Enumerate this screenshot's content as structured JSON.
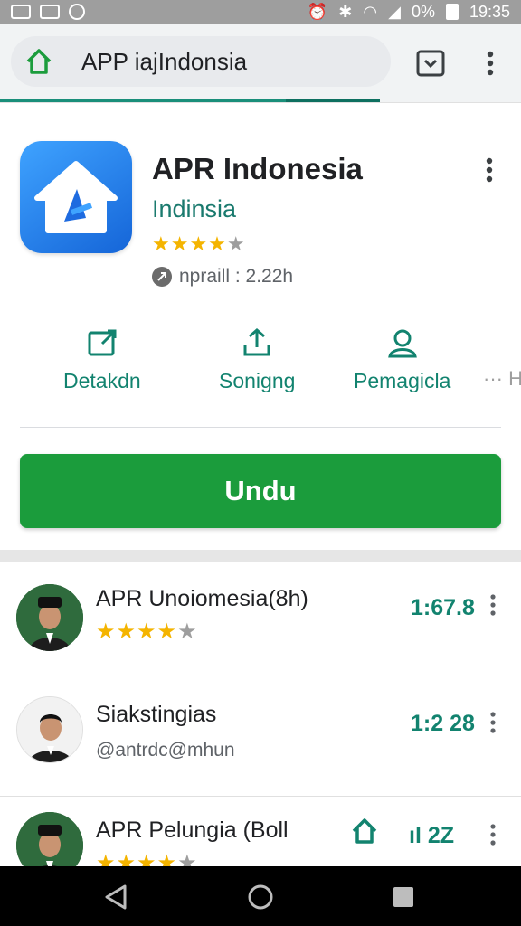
{
  "status_bar": {
    "battery": "0%",
    "time": "19:35"
  },
  "browser": {
    "url": "APP iajIndonsia",
    "load_progress": 0.73
  },
  "app": {
    "title": "APR Indonesia",
    "developer": "Indinsia",
    "stars": "★★★★",
    "stars_off": "★",
    "rating": 4,
    "info_text": "npraill : 2.22h"
  },
  "actions": [
    {
      "label": "Detakdn",
      "icon": "share-icon"
    },
    {
      "label": "Sonigng",
      "icon": "upload-icon"
    },
    {
      "label": "Pemagicla",
      "icon": "person-icon"
    }
  ],
  "actions_more": "··· H",
  "install_button": "Undu",
  "list": [
    {
      "title": "APR Unoiomesia(8h)",
      "stars": "★★★★",
      "stars_off": "★",
      "rating": 4,
      "value": "1:67.8"
    },
    {
      "title": "Siakstingias",
      "subtitle": "@antrdc@mhun",
      "value": "1:2 28"
    },
    {
      "title": "APR Pelungia (Boll",
      "stars": "★★★★",
      "stars_off": "★",
      "rating": 4,
      "value": "ıl 2Z"
    }
  ],
  "colors": {
    "accent": "#12836f",
    "install": "#1b9c3c",
    "star": "#f4b400",
    "app_icon": "#1e7cf2"
  }
}
